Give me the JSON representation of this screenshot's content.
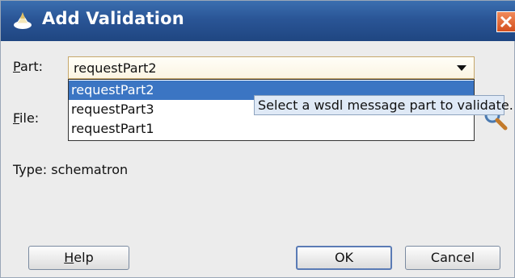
{
  "dialog": {
    "title": "Add Validation",
    "part_label": "Part:",
    "part_mnemonic": "P",
    "part_label_rest": "art:",
    "part_value": "requestPart2",
    "part_options": [
      "requestPart2",
      "requestPart3",
      "requestPart1"
    ],
    "file_label_mnemonic": "F",
    "file_label_rest": "ile:",
    "file_value": "",
    "tooltip": "Select a wsdl message part to validate.",
    "type_text": "Type: schematron",
    "buttons": {
      "help_mnemonic": "H",
      "help_rest": "elp",
      "ok": "OK",
      "cancel": "Cancel"
    }
  },
  "colors": {
    "titlebar": "#2a5596",
    "selection": "#3b75c3",
    "tooltip_bg": "#dfe9f6",
    "close": "#d4501f"
  },
  "icons": {
    "title": "feather-icon",
    "close": "close-icon",
    "search": "search-icon"
  }
}
